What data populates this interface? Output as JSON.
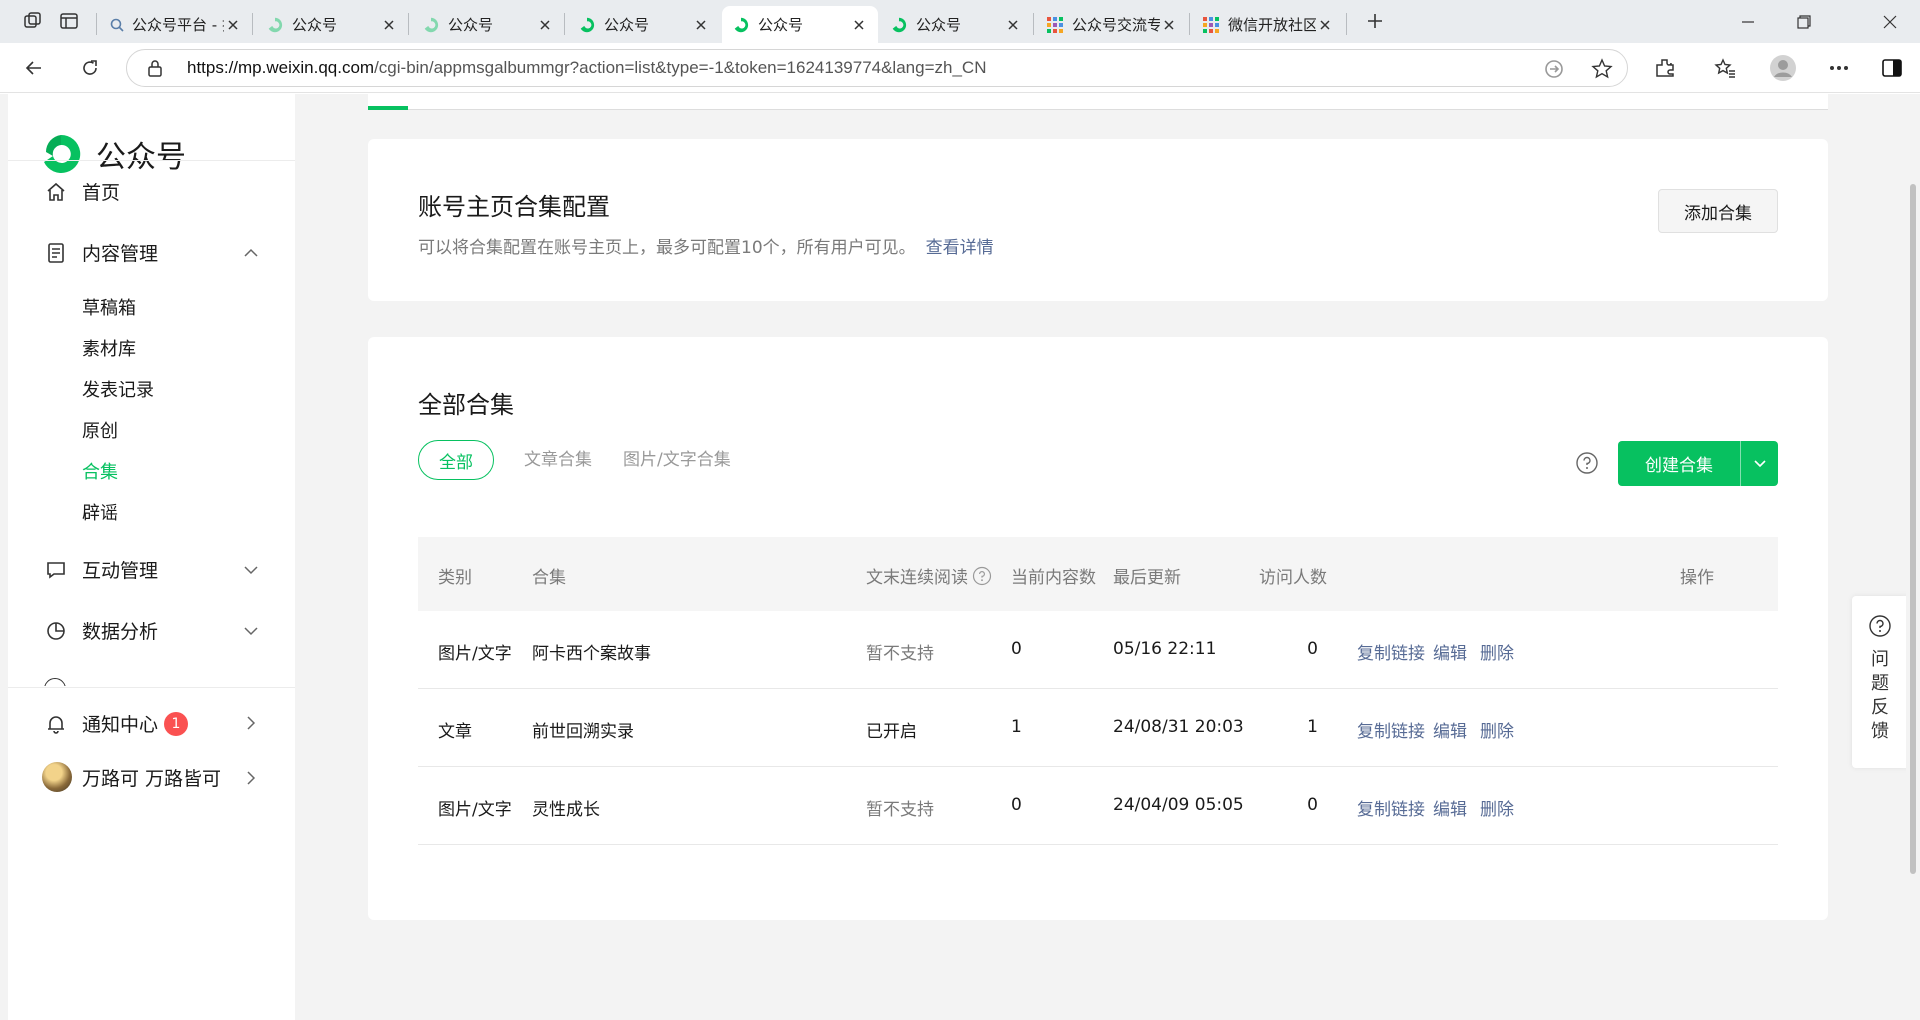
{
  "browser": {
    "tabs": [
      {
        "title": "公众号平台 - 搜索"
      },
      {
        "title": "公众号"
      },
      {
        "title": "公众号"
      },
      {
        "title": "公众号"
      },
      {
        "title": "公众号"
      },
      {
        "title": "公众号"
      },
      {
        "title": "公众号交流专区 |"
      },
      {
        "title": "微信开放社区"
      }
    ],
    "url_host": "https://mp.weixin.qq.com",
    "url_path": "/cgi-bin/appmsgalbummgr?action=list&type=-1&token=1624139774&lang=zh_CN"
  },
  "sidebar": {
    "logo_text": "公众号",
    "home": "首页",
    "content_mgmt": "内容管理",
    "sub_items": [
      "草稿箱",
      "素材库",
      "发表记录",
      "原创",
      "合集",
      "辟谣"
    ],
    "interaction_mgmt": "互动管理",
    "data_analysis": "数据分析",
    "notification": "通知中心",
    "notification_count": "1",
    "account_name": "万路可 万路皆可"
  },
  "config_card": {
    "title": "账号主页合集配置",
    "desc": "可以将合集配置在账号主页上，最多可配置10个，所有用户可见。",
    "detail_link": "查看详情",
    "add_button": "添加合集"
  },
  "albums_card": {
    "title": "全部合集",
    "filters": [
      "全部",
      "文章合集",
      "图片/文字合集"
    ],
    "create_button": "创建合集",
    "columns": [
      "类别",
      "合集",
      "文末连续阅读",
      "当前内容数",
      "最后更新",
      "访问人数",
      "操作"
    ],
    "rows": [
      {
        "type": "图片/文字",
        "name": "阿卡西个案故事",
        "continuous": "暂不支持",
        "count": "0",
        "updated": "05/16 22:11",
        "visitors": "0"
      },
      {
        "type": "文章",
        "name": "前世回溯实录",
        "continuous": "已开启",
        "count": "1",
        "updated": "24/08/31 20:03",
        "visitors": "1"
      },
      {
        "type": "图片/文字",
        "name": "灵性成长",
        "continuous": "暂不支持",
        "count": "0",
        "updated": "24/04/09 05:05",
        "visitors": "0"
      }
    ],
    "ops": {
      "copy": "复制链接",
      "edit": "编辑",
      "delete": "删除"
    }
  },
  "feedback": {
    "chars": [
      "问",
      "题",
      "反",
      "馈"
    ]
  },
  "colors": {
    "accent": "#07c160",
    "link": "#576b95",
    "badge": "#fa5151"
  }
}
